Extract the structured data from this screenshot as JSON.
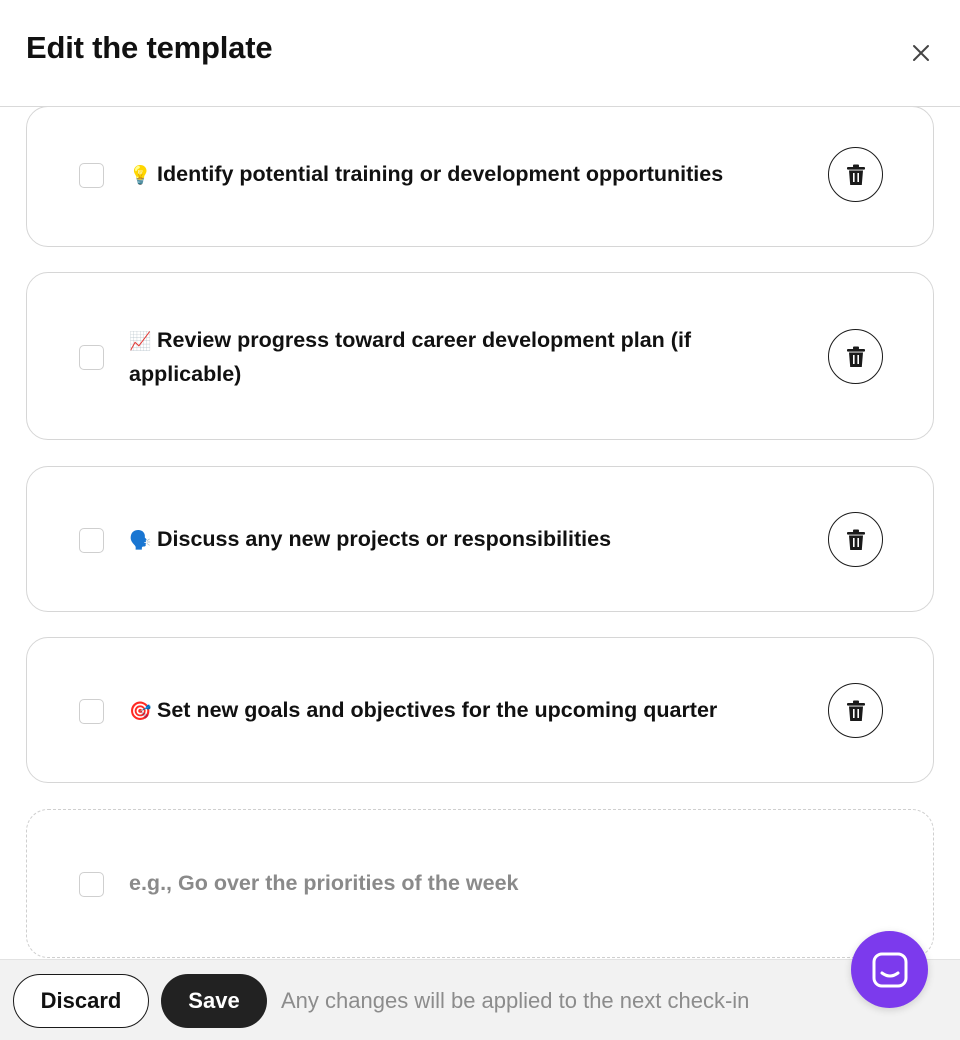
{
  "header": {
    "title": "Edit the template",
    "close_icon": "close-icon"
  },
  "items": [
    {
      "emoji": "💡",
      "text": "Identify potential training or development opportunities",
      "checked": false
    },
    {
      "emoji": "📈",
      "text": "Review progress toward career development plan (if applicable)",
      "checked": false
    },
    {
      "emoji": "🗣️",
      "text": "Discuss any new projects or responsibilities",
      "checked": false
    },
    {
      "emoji": "🎯",
      "text": "Set new goals and objectives for the upcoming quarter",
      "checked": false
    }
  ],
  "new_item": {
    "placeholder": "e.g., Go over the priorities of the week"
  },
  "footer": {
    "discard_label": "Discard",
    "save_label": "Save",
    "note": "Any changes will be applied to the next check-in"
  },
  "icons": {
    "delete": "trash-icon",
    "chat": "chat-icon"
  },
  "colors": {
    "accent": "#7c3aed",
    "save_bg": "#222222",
    "muted_text": "#8c8c8c"
  }
}
